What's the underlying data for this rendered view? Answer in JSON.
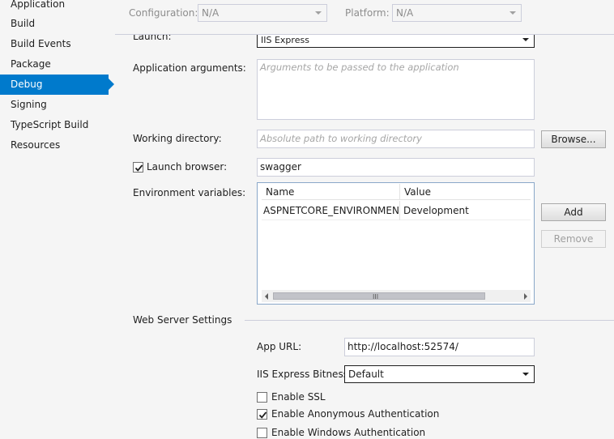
{
  "sidebar": {
    "items": [
      {
        "label": "Application",
        "selected": false
      },
      {
        "label": "Build",
        "selected": false
      },
      {
        "label": "Build Events",
        "selected": false
      },
      {
        "label": "Package",
        "selected": false
      },
      {
        "label": "Debug",
        "selected": true
      },
      {
        "label": "Signing",
        "selected": false
      },
      {
        "label": "TypeScript Build",
        "selected": false
      },
      {
        "label": "Resources",
        "selected": false
      }
    ]
  },
  "toolbar": {
    "configuration_label": "Configuration:",
    "configuration_value": "N/A",
    "platform_label": "Platform:",
    "platform_value": "N/A"
  },
  "launch": {
    "label": "Launch:",
    "value": "IIS Express"
  },
  "app_args": {
    "label": "Application arguments:",
    "placeholder": "Arguments to be passed to the application"
  },
  "working_dir": {
    "label": "Working directory:",
    "placeholder": "Absolute path to working directory",
    "browse_label": "Browse..."
  },
  "launch_browser": {
    "label": "Launch browser:",
    "checked": true,
    "value": "swagger"
  },
  "env_vars": {
    "label": "Environment variables:",
    "columns": [
      "Name",
      "Value"
    ],
    "rows": [
      {
        "name": "ASPNETCORE_ENVIRONMENT",
        "value": "Development"
      }
    ],
    "scroll_grip": "III",
    "add_label": "Add",
    "remove_label": "Remove"
  },
  "web_server": {
    "section_label": "Web Server Settings",
    "app_url_label": "App URL:",
    "app_url_value": "http://localhost:52574/",
    "bitness_label": "IIS Express Bitness:",
    "bitness_value": "Default",
    "enable_ssl_label": "Enable SSL",
    "enable_ssl_checked": false,
    "anon_auth_label": "Enable Anonymous Authentication",
    "anon_auth_checked": true,
    "windows_auth_label": "Enable Windows Authentication",
    "windows_auth_checked": false
  },
  "colors": {
    "accent": "#007acc",
    "background": "#f5f5f5",
    "input_border": "#cccedb"
  }
}
